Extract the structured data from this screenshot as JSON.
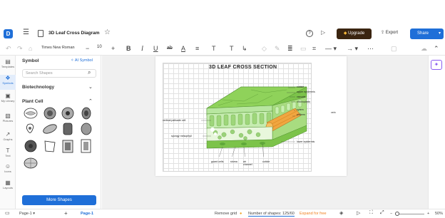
{
  "app": {
    "doc_title": "3D Leaf Cross Diagram",
    "upgrade_label": "Upgrade",
    "export_label": "Export",
    "share_label": "Share"
  },
  "toolbar": {
    "font_name": "Times New Roman",
    "font_size": "10"
  },
  "rail": [
    {
      "label": "Templates",
      "icon": "templates-icon"
    },
    {
      "label": "Symbols",
      "icon": "symbols-icon"
    },
    {
      "label": "My Library",
      "icon": "library-icon"
    },
    {
      "label": "Pictures",
      "icon": "pictures-icon"
    },
    {
      "label": "Graphs",
      "icon": "graphs-icon"
    },
    {
      "label": "Text",
      "icon": "text-icon"
    },
    {
      "label": "Icons",
      "icon": "icons-icon"
    },
    {
      "label": "Layouts",
      "icon": "layouts-icon"
    }
  ],
  "panel": {
    "title": "Symbol",
    "ai_symbol": "AI Symbol",
    "search_placeholder": "Search Shapes",
    "section1": "Biotechnology",
    "section2": "Plant Cell",
    "more_shapes": "More Shapes"
  },
  "diagram": {
    "title": "3D LEAF CROSS SECTION",
    "labels": {
      "cuticle_top": "cuticle",
      "upper_epidermis": "upper epidermis",
      "vacuole": "vacuole",
      "chloroplasts": "chloroplasts",
      "cytem": "cytem",
      "vein": "vein",
      "phloem": "phloem",
      "vertical_palisade": "vertical palisade cell",
      "spongy_mesophyll": "spongy mesophyll",
      "lower_epidermis": "lower epidermis",
      "guard_cells": "guard cells",
      "stoma": "stoma",
      "air_channel": "air channel",
      "cuticle_bottom": "cuticle"
    }
  },
  "status": {
    "page_selector": "Page-1",
    "page_tab": "Page-1",
    "remove_grid": "Remove grid",
    "shapes_count": "Number of shapes: 125/60",
    "expand": "Expand for free",
    "zoom": "50%"
  }
}
